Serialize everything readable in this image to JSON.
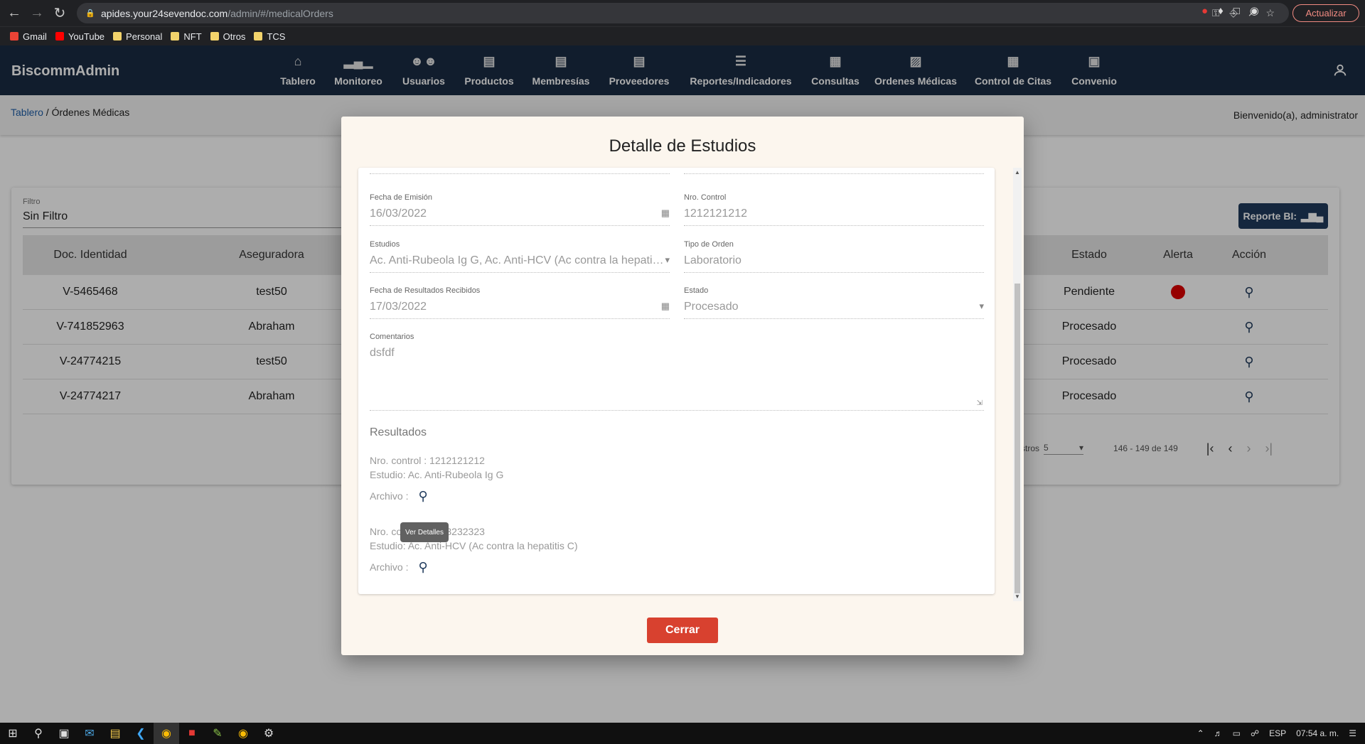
{
  "browser": {
    "url_host": "apides.your24sevendoc.com",
    "url_path": "/admin/#/medicalOrders",
    "update_label": "Actualizar",
    "bookmarks": [
      "Gmail",
      "YouTube",
      "Personal",
      "NFT",
      "Otros",
      "TCS"
    ]
  },
  "header": {
    "brand": "BiscommAdmin",
    "nav": [
      "Tablero",
      "Monitoreo",
      "Usuarios",
      "Productos",
      "Membresías",
      "Proveedores",
      "Reportes/Indicadores",
      "Consultas",
      "Ordenes Médicas",
      "Control de Citas",
      "Convenio"
    ]
  },
  "breadcrumb": {
    "root": "Tablero",
    "separator": " / ",
    "current": "Órdenes Médicas"
  },
  "welcome": "Bienvenido(a), administrator",
  "filter": {
    "label": "Filtro",
    "value": "Sin Filtro"
  },
  "report_button": "Reporte BI:",
  "table": {
    "headers": {
      "doc": "Doc. Identidad",
      "insurer": "Aseguradora",
      "status": "Estado",
      "alert": "Alerta",
      "action": "Acción"
    },
    "rows": [
      {
        "doc": "V-5465468",
        "insurer": "test50",
        "status": "Pendiente",
        "alert": true
      },
      {
        "doc": "V-741852963",
        "insurer": "Abraham",
        "status": "Procesado",
        "alert": false
      },
      {
        "doc": "V-24774215",
        "insurer": "test50",
        "status": "Procesado",
        "alert": false
      },
      {
        "doc": "V-24774217",
        "insurer": "Abraham",
        "status": "Procesado",
        "alert": false
      }
    ]
  },
  "pager": {
    "items_label": "stros",
    "per_page": "5",
    "range": "146 - 149 de 149"
  },
  "modal": {
    "title": "Detalle de Estudios",
    "fields": {
      "fecha_emision": {
        "label": "Fecha de Emisión",
        "value": "16/03/2022"
      },
      "nro_control": {
        "label": "Nro. Control",
        "value": "1212121212"
      },
      "estudios": {
        "label": "Estudios",
        "value": "Ac. Anti-Rubeola Ig G, Ac. Anti-HCV (Ac contra la hepatitis C)"
      },
      "tipo_orden": {
        "label": "Tipo de Orden",
        "value": "Laboratorio"
      },
      "fecha_resultados": {
        "label": "Fecha de Resultados Recibidos",
        "value": "17/03/2022"
      },
      "estado": {
        "label": "Estado",
        "value": "Procesado"
      },
      "comentarios": {
        "label": "Comentarios",
        "value": "dsfdf"
      }
    },
    "results_title": "Resultados",
    "results": [
      {
        "control": "Nro. control : 1212121212",
        "estudio": "Estudio: Ac. Anti-Rubeola Ig G",
        "archivo": "Archivo :"
      },
      {
        "control": "Nro. control : 2323232323",
        "estudio": "Estudio: Ac. Anti-HCV (Ac contra la hepatitis C)",
        "archivo": "Archivo :"
      }
    ],
    "tooltip": "Ver Detalles",
    "close": "Cerrar"
  },
  "taskbar": {
    "lang": "ESP",
    "time": "07:54 a. m."
  }
}
